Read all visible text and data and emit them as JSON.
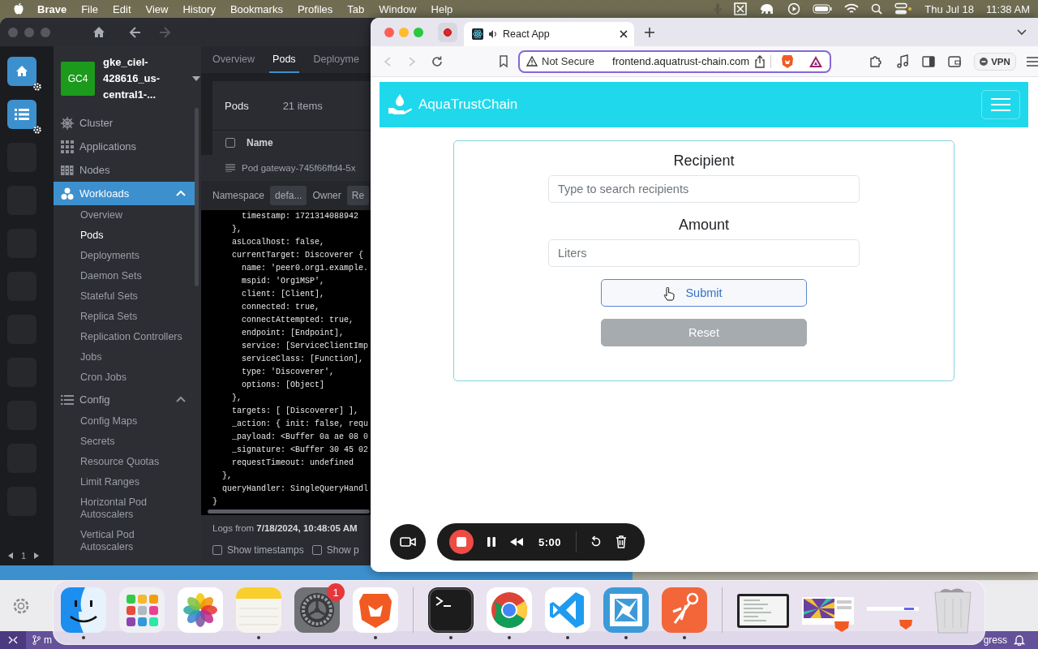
{
  "menubar": {
    "app": "Brave",
    "menus": [
      "File",
      "Edit",
      "View",
      "History",
      "Bookmarks",
      "Profiles",
      "Tab",
      "Window",
      "Help"
    ],
    "date": "Thu Jul 18",
    "time": "11:38 AM"
  },
  "lens": {
    "back": {
      "disabled": false
    },
    "forward": {
      "disabled": true
    },
    "hotbar": {
      "slots": [
        {
          "kind": "home"
        },
        {
          "kind": "list"
        },
        {
          "kind": "empty"
        },
        {
          "kind": "empty"
        },
        {
          "kind": "empty"
        },
        {
          "kind": "empty"
        },
        {
          "kind": "empty"
        },
        {
          "kind": "empty"
        },
        {
          "kind": "empty"
        },
        {
          "kind": "empty"
        },
        {
          "kind": "empty"
        }
      ],
      "page": "1"
    },
    "cluster": {
      "avatar": "GC4",
      "name": "gke_ciel-428616_us-central1-..."
    },
    "sidebar": {
      "items": [
        {
          "label": "Cluster",
          "selected": false
        },
        {
          "label": "Applications",
          "selected": false
        },
        {
          "label": "Nodes",
          "selected": false
        },
        {
          "label": "Workloads",
          "selected": true,
          "expanded": true,
          "children": [
            {
              "label": "Overview",
              "selected": false
            },
            {
              "label": "Pods",
              "selected": true
            },
            {
              "label": "Deployments",
              "selected": false
            },
            {
              "label": "Daemon Sets",
              "selected": false
            },
            {
              "label": "Stateful Sets",
              "selected": false
            },
            {
              "label": "Replica Sets",
              "selected": false
            },
            {
              "label": "Replication Controllers",
              "selected": false
            },
            {
              "label": "Jobs",
              "selected": false
            },
            {
              "label": "Cron Jobs",
              "selected": false
            }
          ]
        },
        {
          "label": "Config",
          "selected": false,
          "expanded": true,
          "children": [
            {
              "label": "Config Maps",
              "selected": false
            },
            {
              "label": "Secrets",
              "selected": false
            },
            {
              "label": "Resource Quotas",
              "selected": false
            },
            {
              "label": "Limit Ranges",
              "selected": false
            },
            {
              "label": "Horizontal Pod Autoscalers",
              "selected": false
            },
            {
              "label": "Vertical Pod Autoscalers",
              "selected": false
            }
          ]
        }
      ]
    },
    "tabs": [
      {
        "label": "Overview",
        "selected": false
      },
      {
        "label": "Pods",
        "selected": true
      },
      {
        "label": "Deployme",
        "selected": false
      }
    ],
    "pods": {
      "title": "Pods",
      "count": "21 items",
      "select_all": {
        "checked": false
      },
      "columns": [
        "Name"
      ]
    },
    "log_panel": {
      "title": "Pod gateway-745f66ffd4-5x",
      "namespace_label": "Namespace",
      "namespace": "defa...",
      "owner_label": "Owner",
      "owner": "Re",
      "lines": [
        "      timestamp: 1721314088942",
        "    },",
        "    asLocalhost: false,",
        "    currentTarget: Discoverer {",
        "      name: 'peer0.org1.example.",
        "      mspid: 'Org1MSP',",
        "      client: [Client],",
        "      connected: true,",
        "      connectAttempted: true,",
        "      endpoint: [Endpoint],",
        "      service: [ServiceClientImp",
        "      serviceClass: [Function],",
        "      type: 'Discoverer',",
        "      options: [Object]",
        "    },",
        "    targets: [ [Discoverer] ],",
        "    _action: { init: false, requ",
        "    _payload: <Buffer 0a ae 08 0",
        "    _signature: <Buffer 30 45 02",
        "    requestTimeout: undefined",
        "  },",
        "  queryHandler: SingleQueryHandl",
        "}"
      ],
      "footer": "Logs from **7/18/2024, 10:48:05 AM**",
      "options": [
        {
          "label": "Show timestamps",
          "checked": false
        },
        {
          "label": "Show p",
          "checked": false
        }
      ]
    }
  },
  "browser": {
    "tab": {
      "title": "React App",
      "muted": false
    },
    "back": {
      "disabled": true
    },
    "forward": {
      "disabled": true
    },
    "address": {
      "warning": "Not Secure",
      "url": "frontend.aquatrust-chain.com"
    },
    "vpn": "VPN"
  },
  "page": {
    "brand": "AquaTrustChain",
    "fields": [
      {
        "label": "Recipient",
        "placeholder": "Type to search recipients"
      },
      {
        "label": "Amount",
        "placeholder": "Liters"
      }
    ],
    "buttons": [
      {
        "label": "Submit",
        "kind": "primary",
        "disabled": false
      },
      {
        "label": "Reset",
        "kind": "secondary",
        "disabled": true
      }
    ]
  },
  "recorder": {
    "time": "5:00"
  },
  "dock": {
    "apps": [
      {
        "running": true
      },
      {
        "running": false
      },
      {
        "running": false
      },
      {
        "running": true
      },
      {
        "running": false,
        "badge": "1"
      },
      {
        "running": true
      },
      {
        "running": true
      },
      {
        "running": true
      },
      {
        "running": true
      },
      {
        "running": true
      },
      {
        "running": true
      }
    ],
    "windows": [
      {
        "kind": "editor"
      },
      {
        "kind": "video"
      },
      {
        "kind": "web"
      }
    ]
  },
  "editor_status": {
    "branch": "m",
    "right": "gress"
  }
}
